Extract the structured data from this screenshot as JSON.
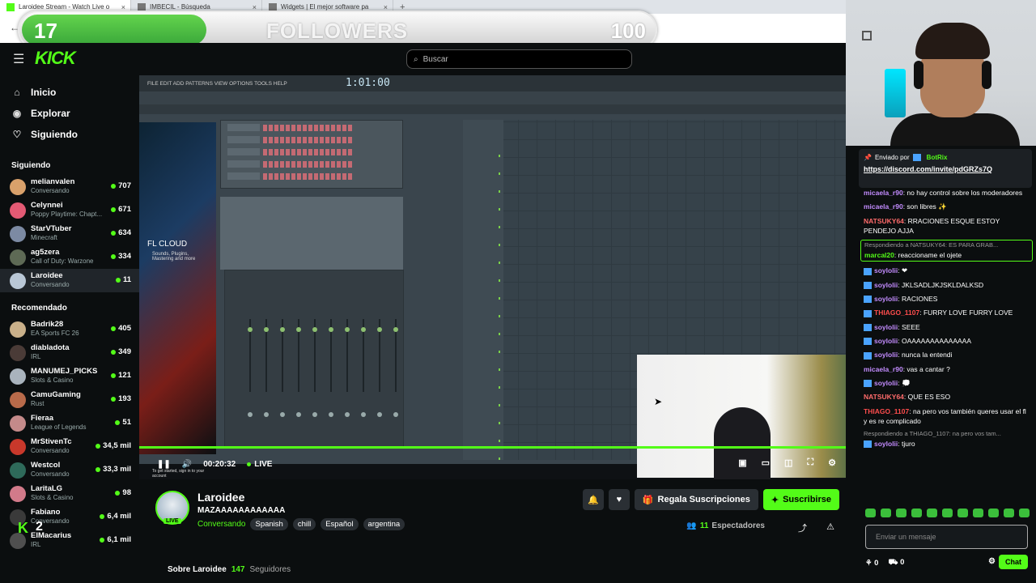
{
  "browser": {
    "tabs": [
      {
        "title": "Laroidee Stream - Watch Live o",
        "active": true,
        "close": "×"
      },
      {
        "title": "IMBECIL - Búsqueda",
        "active": false,
        "close": "×"
      },
      {
        "title": "Widgets | El mejor software pa",
        "active": false,
        "close": "×"
      }
    ],
    "new_tab": "+",
    "url_fragment": "roidee"
  },
  "follower_goal": {
    "current": "17",
    "label": "FOLLOWERS",
    "goal": "100",
    "progress_fraction": 0.17
  },
  "header": {
    "logo": "KICK",
    "search_placeholder": "Buscar"
  },
  "sidebar": {
    "nav": [
      {
        "icon": "home-icon",
        "label": "Inicio"
      },
      {
        "icon": "compass-icon",
        "label": "Explorar"
      },
      {
        "icon": "heart-icon",
        "label": "Siguiendo"
      }
    ],
    "following_title": "Siguiendo",
    "following": [
      {
        "name": "melianvalen",
        "category": "Conversando",
        "viewers": "707",
        "color": "#d9a16b"
      },
      {
        "name": "Celynnei",
        "category": "Poppy Playtime: Chapt...",
        "viewers": "671",
        "color": "#e35a74"
      },
      {
        "name": "StarVTuber",
        "category": "Minecraft",
        "viewers": "634",
        "color": "#7c8aa3"
      },
      {
        "name": "ag5zera",
        "category": "Call of Duty: Warzone",
        "viewers": "334",
        "color": "#5e6a55"
      },
      {
        "name": "Laroidee",
        "category": "Conversando",
        "viewers": "11",
        "color": "#b9c7d6",
        "selected": true
      }
    ],
    "recommended_title": "Recomendado",
    "recommended": [
      {
        "name": "Badrik28",
        "category": "EA Sports FC 26",
        "viewers": "405",
        "color": "#c9b08a"
      },
      {
        "name": "diabladota",
        "category": "IRL",
        "viewers": "349",
        "color": "#4a3b37"
      },
      {
        "name": "MANUMEJ_PICKS",
        "category": "Slots & Casino",
        "viewers": "121",
        "color": "#a9b3bd"
      },
      {
        "name": "CamuGaming",
        "category": "Rust",
        "viewers": "193",
        "color": "#b86a4a"
      },
      {
        "name": "Fieraa",
        "category": "League of Legends",
        "viewers": "51",
        "color": "#c48a8a"
      },
      {
        "name": "MrStivenTc",
        "category": "Conversando",
        "viewers": "34,5 mil",
        "color": "#c8382b"
      },
      {
        "name": "Westcol",
        "category": "Conversando",
        "viewers": "33,3 mil",
        "color": "#2e6a5a"
      },
      {
        "name": "LaritaLG",
        "category": "Slots & Casino",
        "viewers": "98",
        "color": "#d27a8a"
      },
      {
        "name": "Fabiano",
        "category": "Conversando",
        "viewers": "6,4 mil",
        "color": "#3a3a3a"
      },
      {
        "name": "ElMacarius",
        "category": "IRL",
        "viewers": "6,1 mil",
        "color": "#4f4f4f"
      }
    ],
    "overlay_logo": "K",
    "overlay_count": "2"
  },
  "fl_studio": {
    "menu": "FILE EDIT ADD PATTERNS VIEW OPTIONS TOOLS HELP",
    "time": "1:01:00",
    "promo_title": "FL CLOUD",
    "promo_desc": "Sounds, Plugins, Mastering and more",
    "promo_signin": "To get started, sign in to your account"
  },
  "player": {
    "time": "00:20:32",
    "live": "LIVE",
    "progress_fraction": 1.0
  },
  "stream": {
    "name": "Laroidee",
    "title": "MAZAAAAAAAAAAAA",
    "live_tag": "LIVE",
    "category": "Conversando",
    "tags": [
      "Spanish",
      "chill",
      "Español",
      "argentina"
    ],
    "gift_label": "Regala Suscripciones",
    "subscribe_label": "Suscribirse",
    "viewers": "11",
    "viewers_label": "Espectadores",
    "about_label": "Sobre Laroidee",
    "followers_count": "147",
    "followers_label": "Seguidores"
  },
  "chat": {
    "pinned": {
      "sent_by": "Enviado por",
      "bot": "BotRix",
      "link": "https://discord.com/invite/pdGRZs7Q"
    },
    "messages": [
      {
        "user": "micaela_r90",
        "color": "#c38cff",
        "text": "no hay control sobre los moderadores",
        "badge": false
      },
      {
        "user": "micaela_r90",
        "color": "#c38cff",
        "text": "son libres ✨",
        "badge": false
      },
      {
        "user": "NATSUKY64",
        "color": "#ff6b6b",
        "text": "RRACIONES ESQUE ESTOY PENDEJO AJJA",
        "badge": false
      },
      {
        "user": "marcal20",
        "color": "#53fc18",
        "text": "reaccioname el ojete",
        "badge": false,
        "reply": "Respondiendo a NATSUKY64: ES PARA GRAB..."
      },
      {
        "user": "soylolii",
        "color": "#c38cff",
        "text": "❤",
        "badge": true
      },
      {
        "user": "soylolii",
        "color": "#c38cff",
        "text": "JKLSADLJKJSKLDALKSD",
        "badge": true
      },
      {
        "user": "soylolii",
        "color": "#c38cff",
        "text": "RACIONES",
        "badge": true
      },
      {
        "user": "THIAGO_1107",
        "color": "#ff4d4d",
        "text": "FURRY LOVE FURRY LOVE",
        "badge": true
      },
      {
        "user": "soylolii",
        "color": "#c38cff",
        "text": "SEEE",
        "badge": true
      },
      {
        "user": "soylolii",
        "color": "#c38cff",
        "text": "OAAAAAAAAAAAAAA",
        "badge": true
      },
      {
        "user": "soylolii",
        "color": "#c38cff",
        "text": "nunca la entendi",
        "badge": true
      },
      {
        "user": "micaela_r90",
        "color": "#c38cff",
        "text": "vas a cantar ?",
        "badge": false
      },
      {
        "user": "soylolii",
        "color": "#c38cff",
        "text": "💭",
        "badge": true
      },
      {
        "user": "NATSUKY64",
        "color": "#ff6b6b",
        "text": "QUE ES ESO",
        "badge": false
      },
      {
        "user": "THIAGO_1107",
        "color": "#ff4d4d",
        "text": "na pero vos también queres usar el fl y es re complicado",
        "badge": false
      },
      {
        "user": "soylolii",
        "color": "#c38cff",
        "text": "tjuro",
        "badge": true,
        "reply": "Respondiendo a THIAGO_1107: na pero vos tam..."
      }
    ],
    "input_placeholder": "Enviar un mensaje",
    "stat1": "0",
    "stat2": "0",
    "send_label": "Chat"
  }
}
